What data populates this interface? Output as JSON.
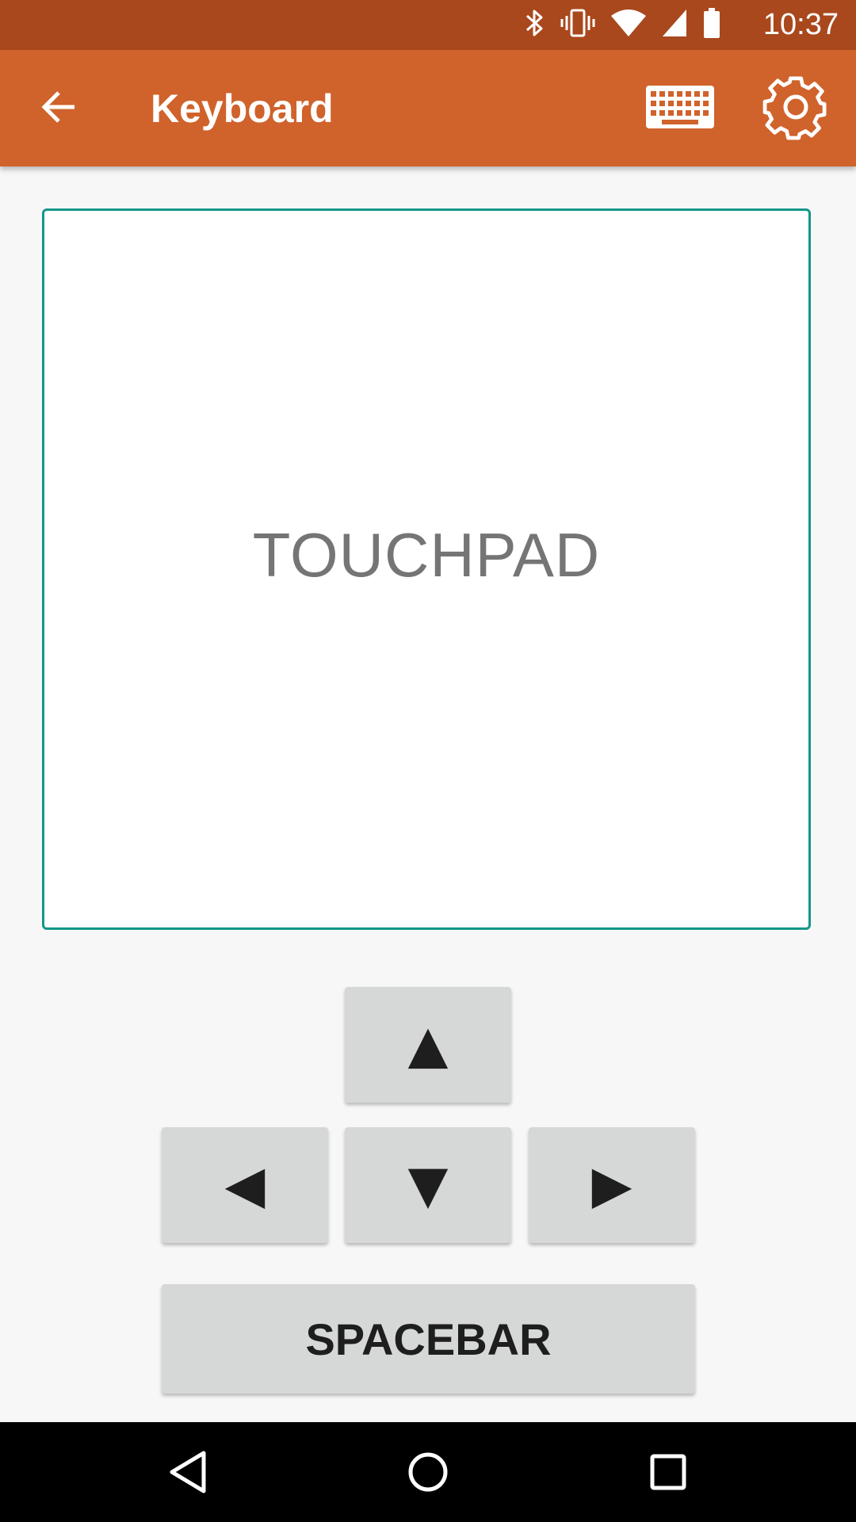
{
  "status_bar": {
    "time": "10:37",
    "icons": [
      "bluetooth-icon",
      "vibrate-icon",
      "wifi-icon",
      "cell-signal-icon",
      "battery-icon"
    ],
    "background": "#a9481d"
  },
  "app_bar": {
    "title": "Keyboard",
    "background": "#d0622b",
    "icons": [
      "back-arrow-icon",
      "keyboard-icon",
      "settings-gear-icon"
    ]
  },
  "touchpad": {
    "label": "TOUCHPAD",
    "border_color": "#14968a"
  },
  "keys": {
    "up": "▲",
    "left": "◀",
    "down": "▼",
    "right": "▶",
    "spacebar": "SPACEBAR"
  },
  "nav_bar": {
    "icons": [
      "nav-back-icon",
      "nav-home-icon",
      "nav-recents-icon"
    ]
  }
}
